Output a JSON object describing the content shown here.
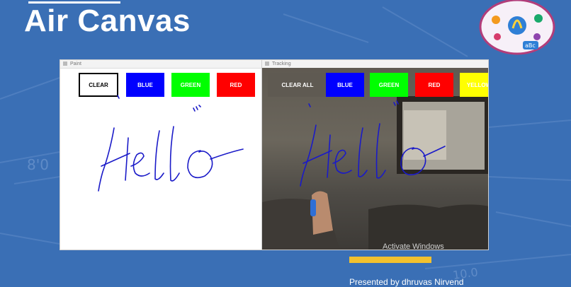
{
  "slide": {
    "title": "Air Canvas",
    "footer_text": "Presented by dhruvas Nirvend",
    "activate_windows": "Activate Windows"
  },
  "paint_window": {
    "title": "Paint",
    "buttons": [
      "CLEAR",
      "BLUE",
      "GREEN",
      "RED"
    ],
    "drawn_text": "Hello"
  },
  "tracking_window": {
    "title": "Tracking",
    "buttons": [
      "CLEAR ALL",
      "BLUE",
      "GREEN",
      "RED",
      "YELLOW"
    ],
    "drawn_text": "Hello"
  },
  "colors": {
    "slide_bg": "#3a6fb5",
    "blue": "#0000ff",
    "green": "#00ff00",
    "red": "#ff0000",
    "yellow": "#ffff00",
    "ink": "#1a1ac8",
    "accent_bar": "#f2c12e"
  },
  "icons": [
    "brain-logo-icon",
    "window-icon"
  ]
}
